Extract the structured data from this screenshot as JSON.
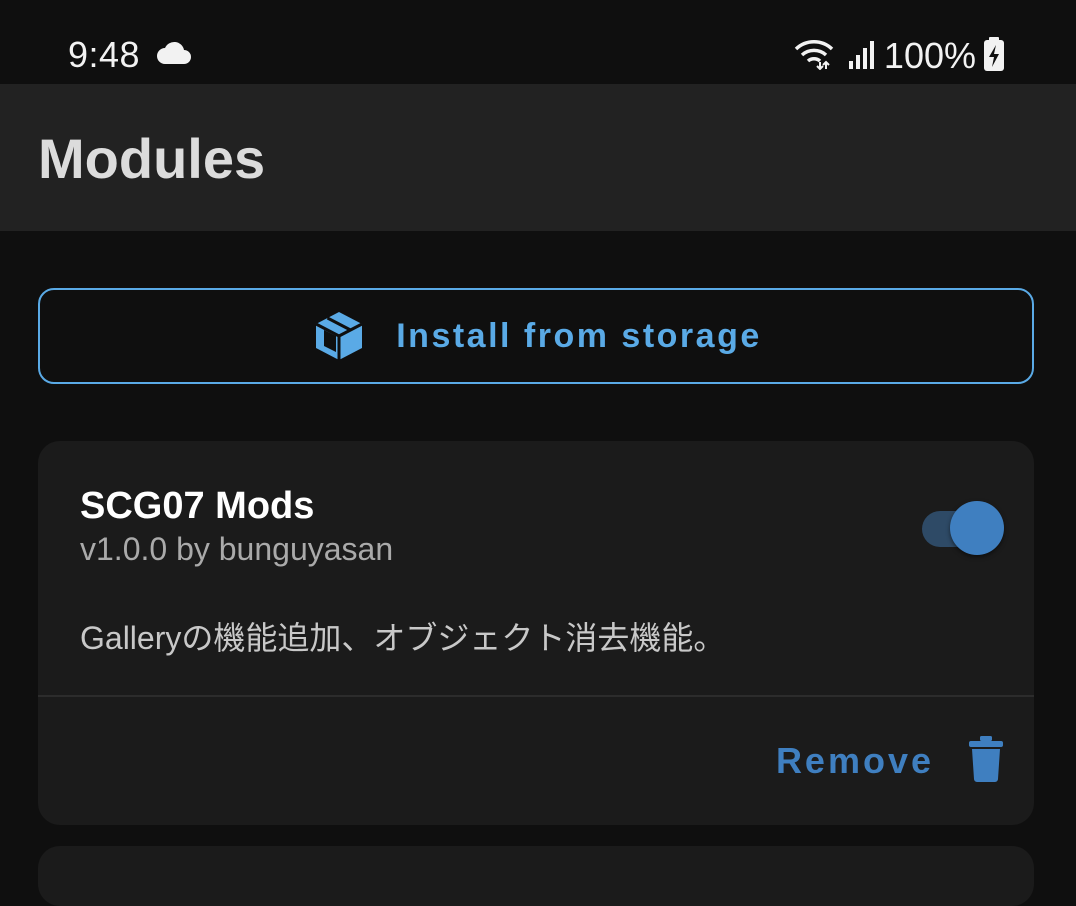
{
  "status_bar": {
    "time": "9:48",
    "battery": "100%",
    "icons": [
      "cloud-icon",
      "wifi-icon",
      "signal-icon",
      "battery-charging-icon"
    ]
  },
  "app_bar": {
    "title": "Modules"
  },
  "install_button": {
    "label": "Install from storage",
    "icon": "package-icon"
  },
  "modules": [
    {
      "name": "SCG07 Mods",
      "meta": "v1.0.0 by bunguyasan",
      "description": "Galleryの機能追加、オブジェクト消去機能。",
      "enabled": true,
      "remove_label": "Remove",
      "remove_icon": "trash-icon"
    }
  ],
  "colors": {
    "accent": "#5aaae6",
    "accent_dim": "#3f7fc0",
    "background": "#0f0f0f",
    "card": "#1b1b1b",
    "app_bar": "#222222"
  }
}
